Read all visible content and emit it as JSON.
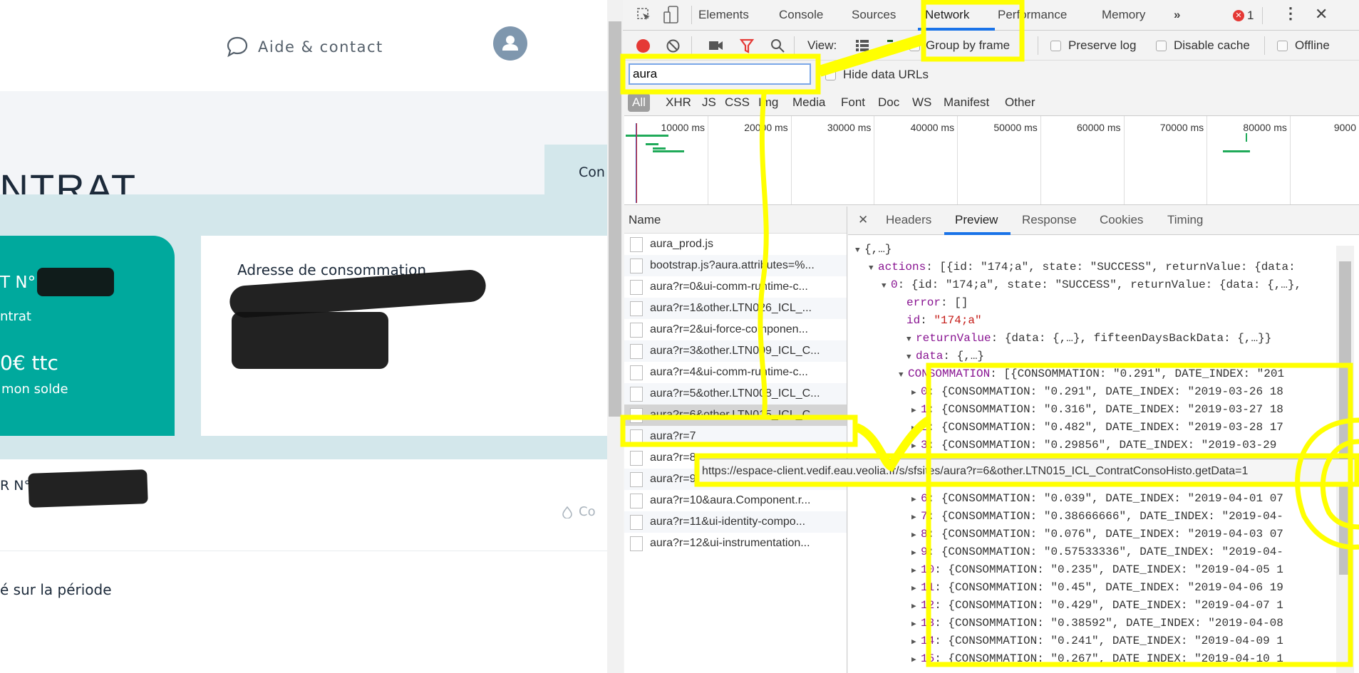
{
  "page": {
    "help_label": "Aide & contact",
    "title": "ONTRAT",
    "tab_partial": "Con",
    "card_green": {
      "contract_no": "T N°",
      "contract_label": "ntrat",
      "amount": "0€ ttc",
      "balance_link": "mon solde"
    },
    "address_heading": "Adresse de consommation",
    "meter_no": "R N°",
    "consumption_partial": "Co",
    "period_label": "é sur la période",
    "colors": {
      "teal": "#00a99d",
      "light_blue": "#d3e7eb",
      "avatar": "#7f97ae"
    }
  },
  "devtools": {
    "tabs": [
      "Elements",
      "Console",
      "Sources",
      "Network",
      "Performance",
      "Memory"
    ],
    "active_tab": "Network",
    "more_tabs": "»",
    "error_count": "1",
    "toolbar": {
      "view_label": "View:",
      "group_by_frame": "Group by frame",
      "preserve_log": "Preserve log",
      "disable_cache": "Disable cache",
      "offline": "Offline"
    },
    "filter": {
      "value": "aura",
      "hide_data_urls": "Hide data URLs"
    },
    "types": [
      "All",
      "XHR",
      "JS",
      "CSS",
      "Img",
      "Media",
      "Font",
      "Doc",
      "WS",
      "Manifest",
      "Other"
    ],
    "timeline_ticks": [
      "10000 ms",
      "20000 ms",
      "30000 ms",
      "40000 ms",
      "50000 ms",
      "60000 ms",
      "70000 ms",
      "80000 ms",
      "9000"
    ],
    "name_header": "Name",
    "requests": [
      "aura_prod.js",
      "bootstrap.js?aura.attributes=%...",
      "aura?r=0&ui-comm-runtime-c...",
      "aura?r=1&other.LTN026_ICL_...",
      "aura?r=2&ui-force-componen...",
      "aura?r=3&other.LTN009_ICL_C...",
      "aura?r=4&ui-comm-runtime-c...",
      "aura?r=5&other.LTN008_ICL_C...",
      "aura?r=6&other.LTN015_ICL_C...",
      "aura?r=7",
      "aura?r=8",
      "aura?r=9&other.LTN015_ICL_C...",
      "aura?r=10&aura.Component.r...",
      "aura?r=11&ui-identity-compo...",
      "aura?r=12&ui-instrumentation..."
    ],
    "selected_request": "aura?r=6&other.LTN015_ICL_C...",
    "tooltip": "https://espace-client.vedif.eau.veolia.fr/s/sfsites/aura?r=6&other.LTN015_ICL_ContratConsoHisto.getData=1",
    "detail_tabs": [
      "Headers",
      "Preview",
      "Response",
      "Cookies",
      "Timing"
    ],
    "active_detail_tab": "Preview",
    "preview": [
      {
        "depth": 0,
        "arrow": "down",
        "key": "",
        "text": "{,…}"
      },
      {
        "depth": 1,
        "arrow": "down",
        "key": "actions",
        "text": ": [{id: \"174;a\", state: \"SUCCESS\", returnValue: {data:"
      },
      {
        "depth": 2,
        "arrow": "down",
        "key": "0",
        "text": ": {id: \"174;a\", state: \"SUCCESS\", returnValue: {data: {,…},"
      },
      {
        "depth": 3,
        "arrow": "",
        "key": "error",
        "text": ": []"
      },
      {
        "depth": 3,
        "arrow": "",
        "key": "id",
        "text": ": ",
        "str": "\"174;a\""
      },
      {
        "depth": 3,
        "arrow": "down",
        "key": "returnValue",
        "text": ": {data: {,…}, fifteenDaysBackData: {,…}}"
      },
      {
        "depth": 4,
        "arrow": "down",
        "key": "data",
        "text": ": {,…}"
      },
      {
        "depth": 5,
        "arrow": "down",
        "key": "CONSOMMATION",
        "text": ": [{CONSOMMATION: \"0.291\", DATE_INDEX: \"201"
      },
      {
        "depth": 6,
        "arrow": "right",
        "key": "0",
        "text": ": {CONSOMMATION: \"0.291\", DATE_INDEX: \"2019-03-26 18"
      },
      {
        "depth": 6,
        "arrow": "right",
        "key": "1",
        "text": ": {CONSOMMATION: \"0.316\", DATE_INDEX: \"2019-03-27 18"
      },
      {
        "depth": 6,
        "arrow": "right",
        "key": "2",
        "text": ": {CONSOMMATION: \"0.482\", DATE_INDEX: \"2019-03-28 17"
      },
      {
        "depth": 6,
        "arrow": "right",
        "key": "3",
        "text": ": {CONSOMMATION: \"0.29856\", DATE_INDEX: \"2019-03-29"
      },
      {
        "depth": 6,
        "arrow": "",
        "key": "",
        "text": ""
      },
      {
        "depth": 6,
        "arrow": "",
        "key": "",
        "text": ""
      },
      {
        "depth": 6,
        "arrow": "right",
        "key": "6",
        "text": ": {CONSOMMATION: \"0.039\", DATE_INDEX: \"2019-04-01 07"
      },
      {
        "depth": 6,
        "arrow": "right",
        "key": "7",
        "text": ": {CONSOMMATION: \"0.38666666\", DATE_INDEX: \"2019-04-"
      },
      {
        "depth": 6,
        "arrow": "right",
        "key": "8",
        "text": ": {CONSOMMATION: \"0.076\", DATE_INDEX: \"2019-04-03 07"
      },
      {
        "depth": 6,
        "arrow": "right",
        "key": "9",
        "text": ": {CONSOMMATION: \"0.57533336\", DATE_INDEX: \"2019-04-"
      },
      {
        "depth": 6,
        "arrow": "right",
        "key": "10",
        "text": ": {CONSOMMATION: \"0.235\", DATE_INDEX: \"2019-04-05 1"
      },
      {
        "depth": 6,
        "arrow": "right",
        "key": "11",
        "text": ": {CONSOMMATION: \"0.45\", DATE_INDEX: \"2019-04-06 19"
      },
      {
        "depth": 6,
        "arrow": "right",
        "key": "12",
        "text": ": {CONSOMMATION: \"0.429\", DATE_INDEX: \"2019-04-07 1"
      },
      {
        "depth": 6,
        "arrow": "right",
        "key": "13",
        "text": ": {CONSOMMATION: \"0.38592\", DATE_INDEX: \"2019-04-08"
      },
      {
        "depth": 6,
        "arrow": "right",
        "key": "14",
        "text": ": {CONSOMMATION: \"0.241\", DATE_INDEX: \"2019-04-09 1"
      },
      {
        "depth": 6,
        "arrow": "right",
        "key": "15",
        "text": ": {CONSOMMATION: \"0.267\", DATE_INDEX: \"2019-04-10 1"
      }
    ],
    "colors": {
      "accent": "#1a73e8",
      "record": "#e53935",
      "annotation": "#ffff00"
    }
  }
}
